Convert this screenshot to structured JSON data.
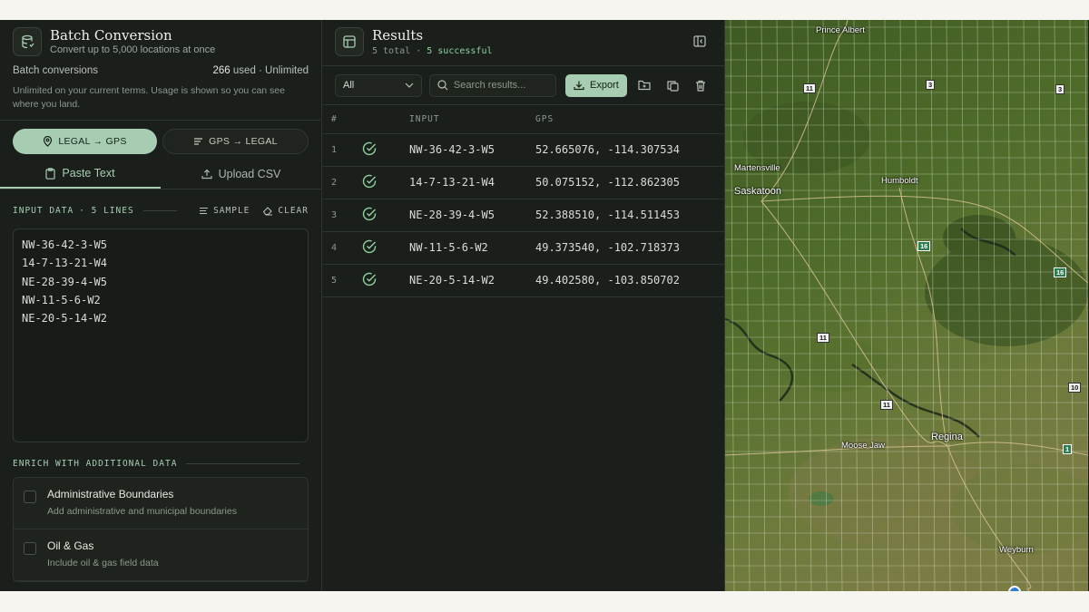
{
  "left": {
    "title": "Batch Conversion",
    "subtitle": "Convert up to 5,000 locations at once",
    "usage_label": "Batch conversions",
    "usage_count": "266",
    "usage_suffix": " used · Unlimited",
    "usage_note": "Unlimited on your current terms. Usage is shown so you can see where you land.",
    "mode_legal_gps": "LEGAL → GPS",
    "mode_gps_legal": "GPS → LEGAL",
    "tab_paste": "Paste Text",
    "tab_upload": "Upload CSV",
    "input_label": "INPUT DATA",
    "input_lines": "· 5 LINES",
    "sample_label": "SAMPLE",
    "clear_label": "CLEAR",
    "input_text": "NW-36-42-3-W5\n14-7-13-21-W4\nNE-28-39-4-W5\nNW-11-5-6-W2\nNE-20-5-14-W2",
    "enrich_label": "ENRICH WITH ADDITIONAL DATA",
    "enrich_items": [
      {
        "title": "Administrative Boundaries",
        "desc": "Add administrative and municipal boundaries"
      },
      {
        "title": "Oil & Gas",
        "desc": "Include oil & gas field data"
      }
    ]
  },
  "results": {
    "title": "Results",
    "total": "5 total",
    "successful": "5 successful",
    "filter_value": "All",
    "search_placeholder": "Search results...",
    "export_label": "Export",
    "col_index": "#",
    "col_input": "INPUT",
    "col_gps": "GPS",
    "rows": [
      {
        "index": "1",
        "input": "NW-36-42-3-W5",
        "gps": "52.665076, -114.307534"
      },
      {
        "index": "2",
        "input": "14-7-13-21-W4",
        "gps": "50.075152, -112.862305"
      },
      {
        "index": "3",
        "input": "NE-28-39-4-W5",
        "gps": "52.388510, -114.511453"
      },
      {
        "index": "4",
        "input": "NW-11-5-6-W2",
        "gps": "49.373540, -102.718373"
      },
      {
        "index": "5",
        "input": "NE-20-5-14-W2",
        "gps": "49.402580, -103.850702"
      }
    ]
  },
  "map": {
    "cities": {
      "prince_albert": "Prince Albert",
      "martensville": "Martensville",
      "saskatoon": "Saskatoon",
      "humboldt": "Humboldt",
      "regina": "Regina",
      "moose_jaw": "Moose Jaw",
      "weyburn": "Weyburn"
    },
    "highways": {
      "h11a": "11",
      "h3a": "3",
      "h3b": "3",
      "h16a": "16",
      "h16b": "16",
      "h11b": "11",
      "h11c": "11",
      "h10": "10",
      "h1": "1"
    }
  },
  "colors": {
    "accent": "#a6cdb2",
    "success": "#8fd29a",
    "panel": "#1b1f1b"
  }
}
